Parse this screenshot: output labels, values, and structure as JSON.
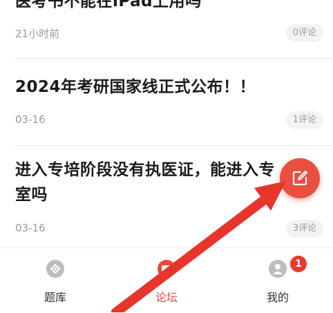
{
  "posts": [
    {
      "title": "医考书不能在iPad上用吗",
      "time": "21小时前",
      "comments": "0评论"
    },
    {
      "title": "2024年考研国家线正式公布！！",
      "time": "03-16",
      "comments": "1评论"
    },
    {
      "title_line1": "进入专培阶段没有执医证，能进入专",
      "title_line2": "室吗",
      "time": "03-16",
      "comments": "3评论"
    }
  ],
  "nav": {
    "items": [
      {
        "label": "题库",
        "icon": "question-bank-icon",
        "active": false
      },
      {
        "label": "论坛",
        "icon": "forum-icon",
        "active": true
      },
      {
        "label": "我的",
        "icon": "profile-icon",
        "active": false
      }
    ],
    "badge": "1"
  },
  "fab": {
    "icon": "edit-icon"
  },
  "colors": {
    "accent": "#e8483b",
    "annotation_arrow": "#e8352c"
  }
}
